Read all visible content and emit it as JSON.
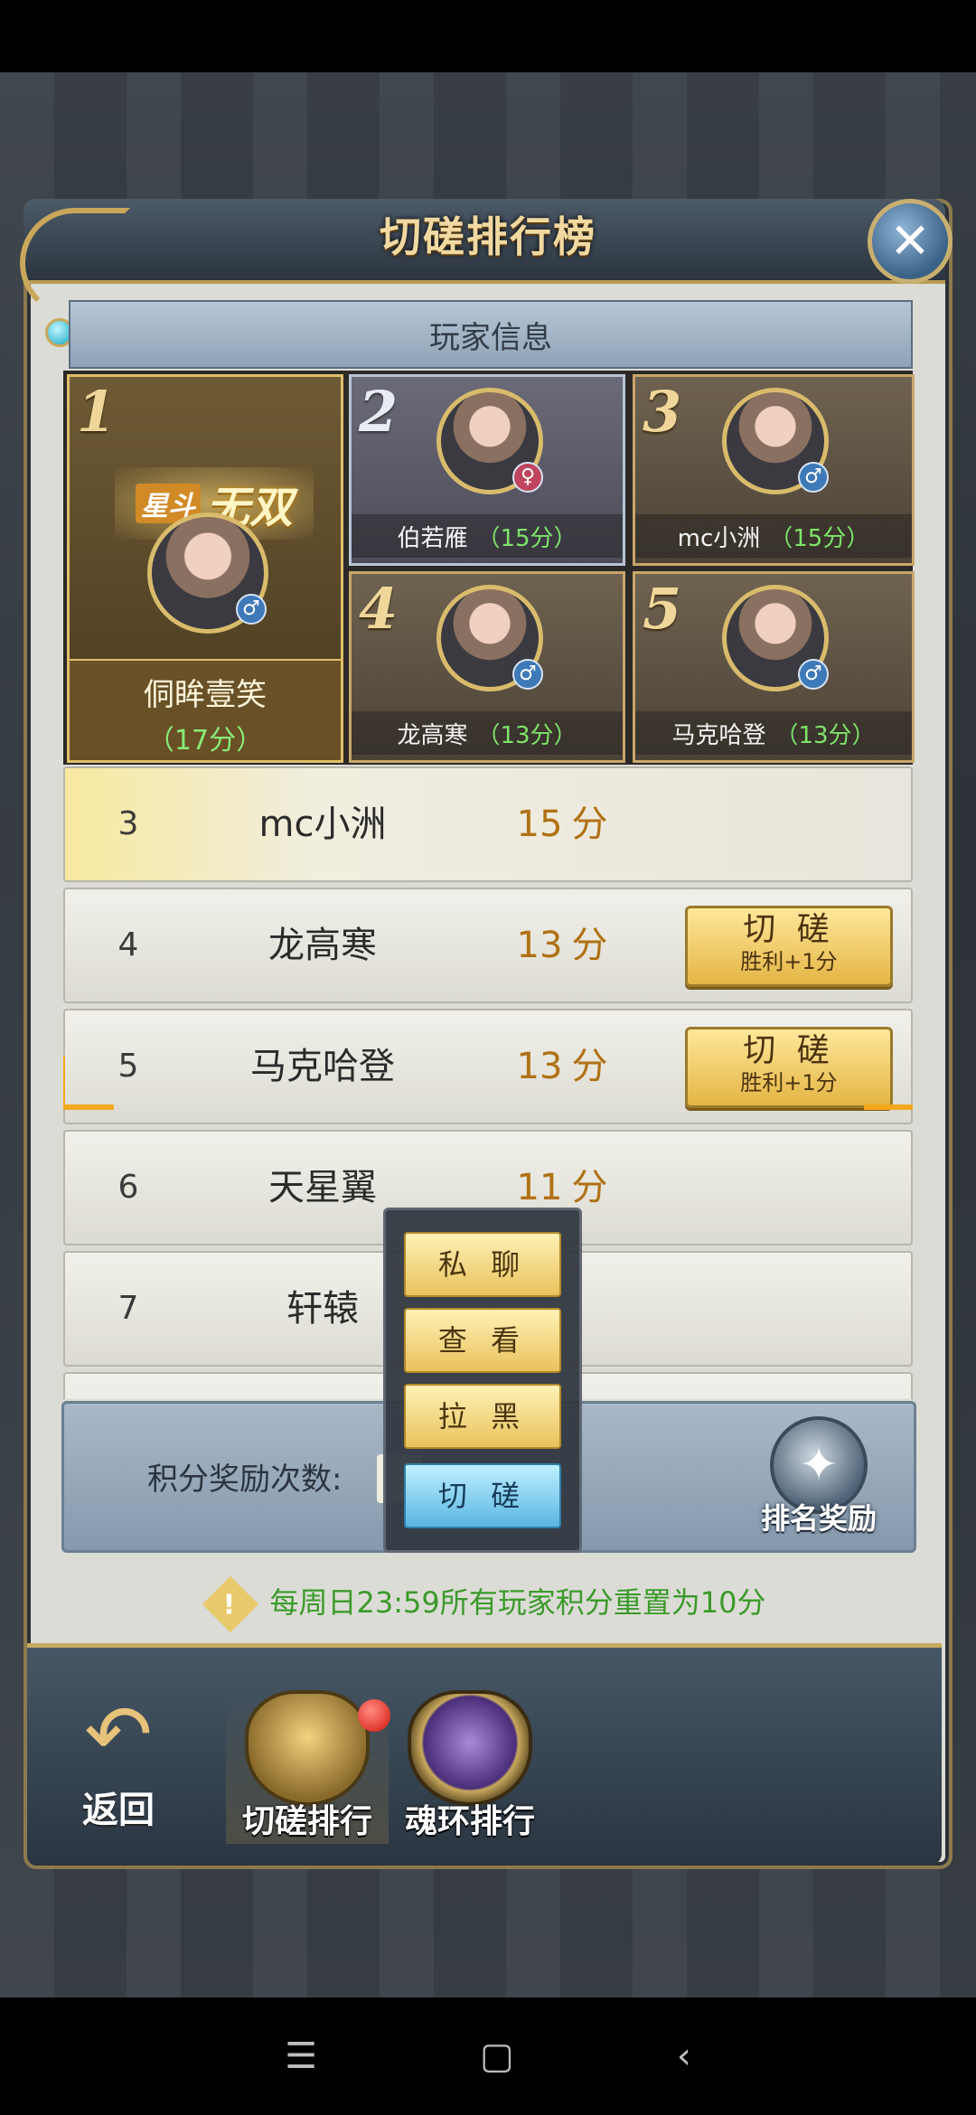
{
  "window": {
    "title": "切磋排行榜"
  },
  "header": {
    "info_label": "玩家信息"
  },
  "top5": {
    "first": {
      "rank": "1",
      "title_prefix": "星斗",
      "title_main": "无双",
      "name": "侗眸壹笑",
      "score": "（17分）",
      "gender": "♂"
    },
    "second": {
      "rank": "2",
      "name": "伯若雁",
      "score": "（15分）",
      "gender": "♀"
    },
    "third": {
      "rank": "3",
      "name": "mc小洲",
      "score": "（15分）",
      "gender": "♂"
    },
    "fourth": {
      "rank": "4",
      "name": "龙高寒",
      "score": "（13分）",
      "gender": "♂"
    },
    "fifth": {
      "rank": "5",
      "name": "马克哈登",
      "score": "（13分）",
      "gender": "♂"
    }
  },
  "list": {
    "score_unit": "分",
    "rows": [
      {
        "rank": "3",
        "name": "mc小洲",
        "score": "15"
      },
      {
        "rank": "4",
        "name": "龙高寒",
        "score": "13"
      },
      {
        "rank": "5",
        "name": "马克哈登",
        "score": "13"
      },
      {
        "rank": "6",
        "name": "天星翼",
        "score": "11"
      },
      {
        "rank": "7",
        "name": "轩辕",
        "score": ""
      }
    ],
    "spar_button": {
      "label": "切 磋",
      "sub": "胜利+1分"
    }
  },
  "reward": {
    "label": "积分奖励次数:",
    "rank_reward": "排名奖励"
  },
  "popup": {
    "items": [
      "私 聊",
      "查 看",
      "拉 黑",
      "切 磋"
    ]
  },
  "notice": {
    "prefix": "每周日23:59所有玩家积分重置为",
    "value": "10分"
  },
  "bottom_nav": {
    "back": "返回",
    "tab1": "切磋排行",
    "tab2": "魂环排行"
  },
  "icons": {
    "close": "close-icon",
    "warning": "warning-icon",
    "back": "back-arrow-icon"
  },
  "colors": {
    "accent_gold": "#e4b544",
    "score_brown": "#b07114",
    "score_green": "#3a9a2a",
    "highlight_orange": "#f4a81c"
  }
}
